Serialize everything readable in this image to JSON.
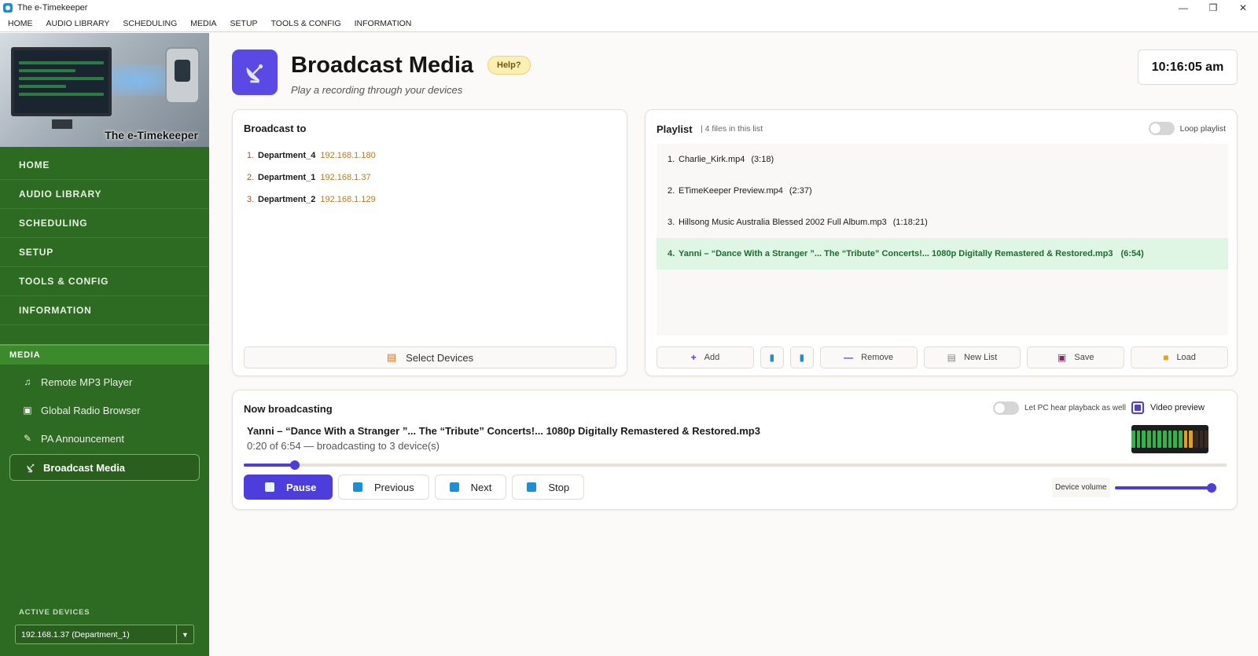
{
  "window": {
    "title": "The e-Timekeeper",
    "controls": [
      "—",
      "❐",
      "✕"
    ]
  },
  "menubar": [
    "HOME",
    "AUDIO LIBRARY",
    "SCHEDULING",
    "MEDIA",
    "SETUP",
    "TOOLS & CONFIG",
    "INFORMATION"
  ],
  "sidebar": {
    "brand": "The e-Timekeeper",
    "nav": [
      "HOME",
      "AUDIO LIBRARY",
      "SCHEDULING",
      "SETUP",
      "TOOLS & CONFIG",
      "INFORMATION"
    ],
    "media_heading": "MEDIA",
    "media_items": [
      {
        "label": "Remote MP3 Player",
        "icon": "music-note-icon"
      },
      {
        "label": "Global Radio Browser",
        "icon": "radio-icon"
      },
      {
        "label": "PA Announcement",
        "icon": "microphone-icon"
      },
      {
        "label": "Broadcast Media",
        "icon": "satellite-dish-icon",
        "active": true
      }
    ],
    "active_devices_label": "ACTIVE DEVICES",
    "active_device_value": "192.168.1.37  (Department_1)"
  },
  "header": {
    "title": "Broadcast Media",
    "help": "Help?",
    "subtitle": "Play a recording through your devices",
    "clock": "10:16:05 am"
  },
  "broadcast_to": {
    "title": "Broadcast to",
    "devices": [
      {
        "num": "1.",
        "name": "Department_4",
        "ip": "192.168.1.180"
      },
      {
        "num": "2.",
        "name": "Department_1",
        "ip": "192.168.1.37"
      },
      {
        "num": "3.",
        "name": "Department_2",
        "ip": "192.168.1.129"
      }
    ],
    "select_button": "Select Devices"
  },
  "playlist": {
    "title": "Playlist",
    "count": "| 4 files in this list",
    "loop_label": "Loop playlist",
    "items": [
      {
        "num": "1.",
        "name": "Charlie_Kirk.mp4",
        "duration": "(3:18)"
      },
      {
        "num": "2.",
        "name": "ETimeKeeper Preview.mp4",
        "duration": "(2:37)"
      },
      {
        "num": "3.",
        "name": "Hillsong Music Australia Blessed 2002 Full Album.mp3",
        "duration": "(1:18:21)"
      },
      {
        "num": "4.",
        "name": "Yanni – “Dance With a Stranger ”... The “Tribute” Concerts!... 1080p Digitally Remastered & Restored.mp3",
        "duration": "(6:54)",
        "active": true
      }
    ],
    "toolbar": {
      "add": "Add",
      "remove": "Remove",
      "new_list": "New List",
      "save": "Save",
      "load": "Load"
    }
  },
  "now": {
    "title": "Now broadcasting",
    "pc_hear_label": "Let PC hear playback as well",
    "video_preview_label": "Video preview",
    "track": "Yanni – “Dance With a Stranger ”... The “Tribute” Concerts!... 1080p Digitally Remastered & Restored.mp3",
    "status": "0:20 of 6:54 — broadcasting to 3 device(s)",
    "progress": 0.052,
    "buttons": {
      "pause": "Pause",
      "previous": "Previous",
      "next": "Next",
      "stop": "Stop"
    },
    "volume_label": "Device volume",
    "volume": 1.0,
    "vu_colors": [
      "#35b34a",
      "#35b34a",
      "#35b34a",
      "#35b34a",
      "#35b34a",
      "#35b34a",
      "#35b34a",
      "#35b34a",
      "#35b34a",
      "#35b34a",
      "#e0a21e",
      "#e0a21e",
      "#3a2a22",
      "#3a2a22",
      "#3a2a22"
    ]
  },
  "colors": {
    "sidebar": "#2e6b22",
    "accent": "#4c3ddc",
    "active_row": "#dff6e4"
  }
}
